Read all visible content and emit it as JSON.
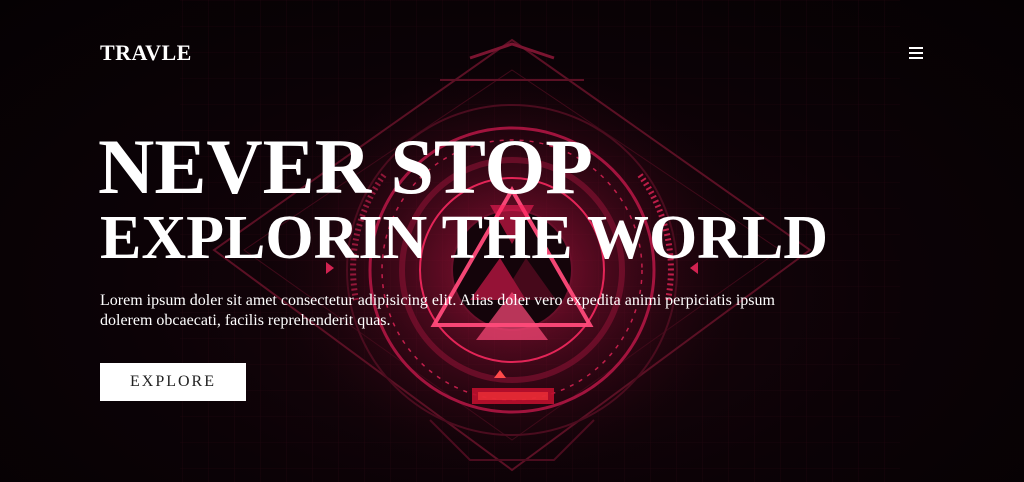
{
  "brand": {
    "logo": "TRAVLE"
  },
  "nav": {
    "menu_icon": "hamburger-menu-icon"
  },
  "hero": {
    "title_line1": "NEVER STOP",
    "title_line2": "EXPLORIN THE WORLD",
    "text": "Lorem ipsum doler sit amet consectetur adipisicing elit. Alias doler vero expedita animi perpiciatis ipsum dolerem obcaecati, facilis reprehenderit quas.",
    "button_label": "EXPLORE"
  },
  "theme": {
    "background": "#0a0205",
    "accent": "#ff1f5a",
    "text": "#ffffff",
    "button_bg": "#ffffff",
    "button_text": "#222222"
  }
}
